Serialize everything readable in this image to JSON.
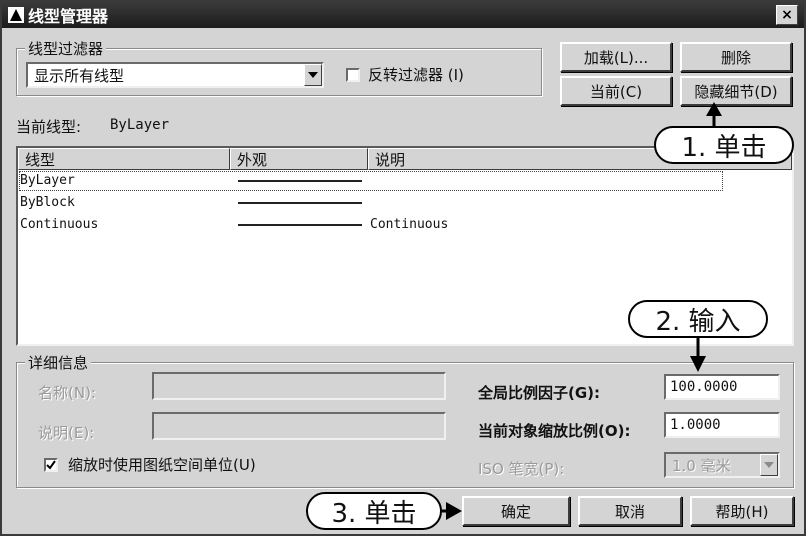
{
  "window": {
    "title": "线型管理器",
    "close_glyph": "×"
  },
  "filter": {
    "group_label": "线型过滤器",
    "selected": "显示所有线型",
    "invert_label": "反转过滤器 (I)",
    "invert_checked": false
  },
  "buttons": {
    "load": "加载(L)...",
    "delete": "删除",
    "current": "当前(C)",
    "hide_details": "隐藏细节(D)",
    "ok": "确定",
    "cancel": "取消",
    "help": "帮助(H)"
  },
  "current_linetype": {
    "label": "当前线型:",
    "value": "ByLayer"
  },
  "list": {
    "columns": [
      "线型",
      "外观",
      "说明"
    ],
    "rows": [
      {
        "name": "ByLayer",
        "description": ""
      },
      {
        "name": "ByBlock",
        "description": ""
      },
      {
        "name": "Continuous",
        "description": "Continuous"
      }
    ]
  },
  "details": {
    "group_label": "详细信息",
    "name_label": "名称(N):",
    "name_value": "",
    "desc_label": "说明(E):",
    "desc_value": "",
    "paper_space_label": "缩放时使用图纸空间单位(U)",
    "paper_space_checked": true,
    "global_scale_label": "全局比例因子(G):",
    "global_scale_value": "100.0000",
    "object_scale_label": "当前对象缩放比例(O):",
    "object_scale_value": "1.0000",
    "pen_width_label": "ISO 笔宽(P):",
    "pen_width_value": "1.0 毫米"
  },
  "annotations": {
    "step1": "1. 单击",
    "step2": "2. 输入",
    "step3": "3. 单击"
  },
  "icons": {
    "app": "autocad-triangle-icon",
    "dropdown": "triangle-down-icon",
    "check": "checkmark-icon",
    "arrow": "arrow-icon"
  }
}
